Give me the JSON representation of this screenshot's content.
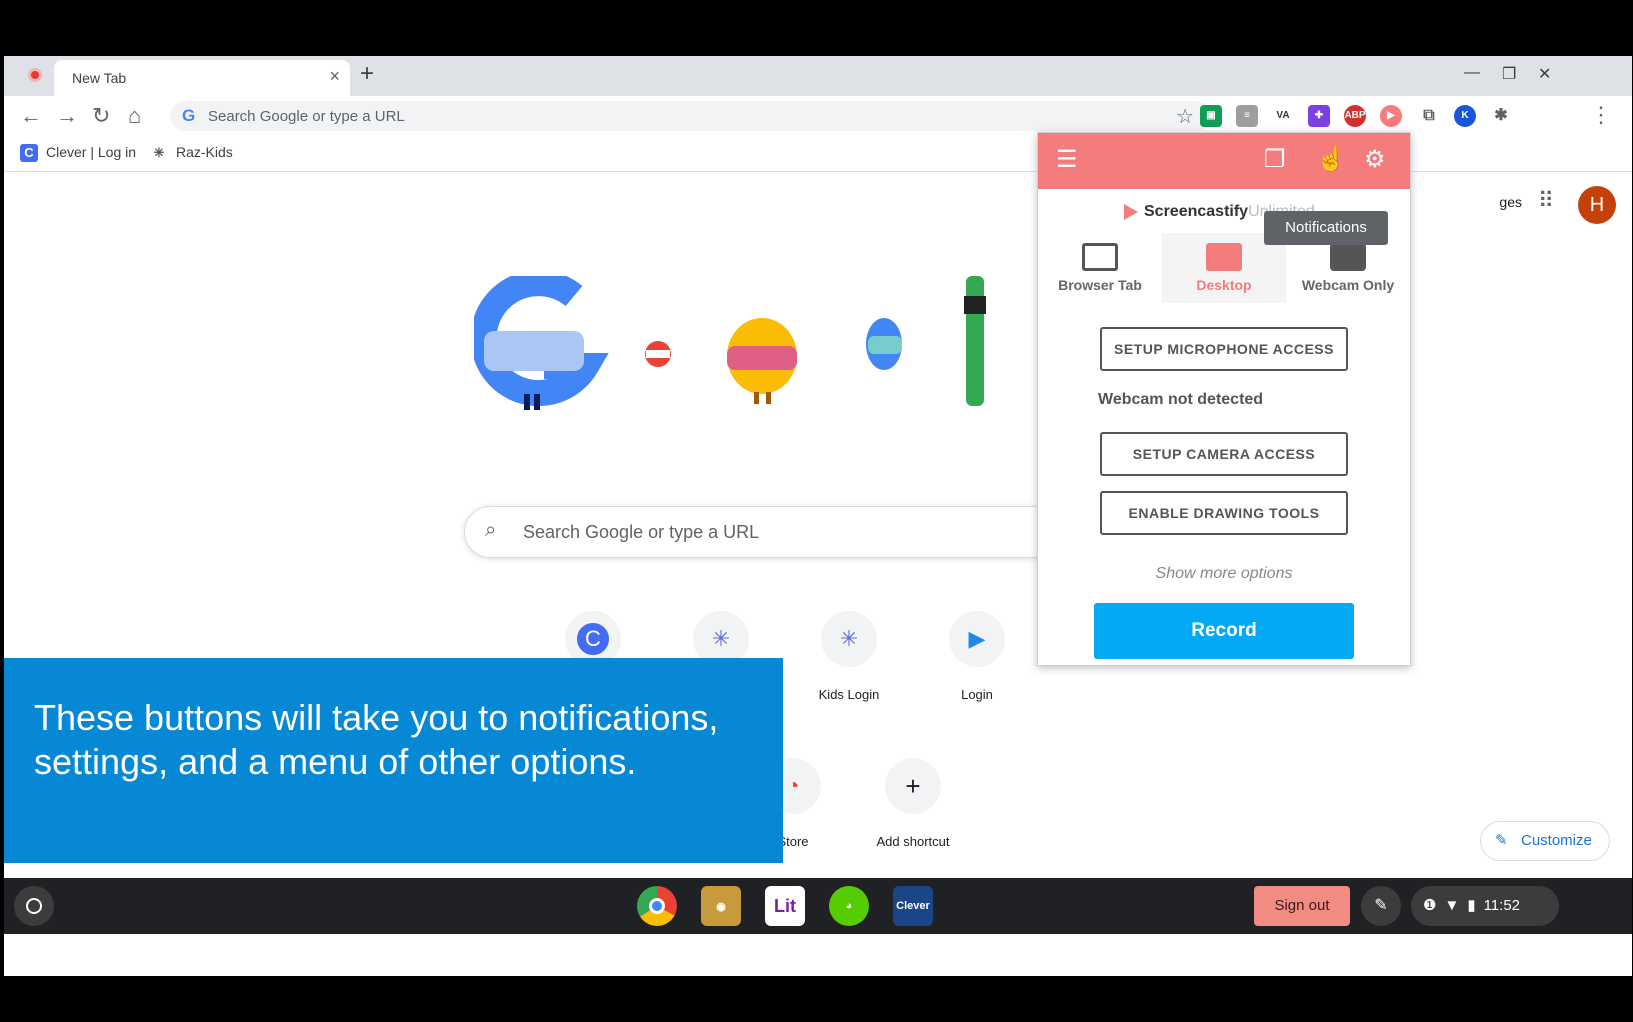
{
  "browser": {
    "tab_title": "New Tab",
    "omnibox_placeholder": "Search Google or type a URL"
  },
  "bookmarks": [
    {
      "label": "Clever | Log in",
      "icon": "clever-icon"
    },
    {
      "label": "Raz-Kids",
      "icon": "raz-kids-icon"
    }
  ],
  "ntp": {
    "search_placeholder": "Search Google or type a URL",
    "images_link": "ges",
    "avatar_letter": "H",
    "shortcuts": [
      {
        "label": "",
        "glyph": "C"
      },
      {
        "label": "",
        "glyph": "✳"
      },
      {
        "label": "Kids Login",
        "glyph": "✳"
      },
      {
        "label": "Login",
        "glyph": "▶"
      },
      {
        "label": "Store",
        "glyph": "◔"
      },
      {
        "label": "Add shortcut",
        "glyph": "+"
      }
    ],
    "customize_label": "Customize"
  },
  "caption": {
    "text": "These buttons will take you to notifications, settings, and a menu of other options."
  },
  "popup": {
    "brand": "Screencastify",
    "brand_sub": "Unlimited",
    "tooltip": "Notifications",
    "modes": [
      {
        "label": "Browser Tab"
      },
      {
        "label": "Desktop"
      },
      {
        "label": "Webcam Only"
      }
    ],
    "setup_mic": "SETUP MICROPHONE ACCESS",
    "webcam_msg": "Webcam not detected",
    "setup_camera": "SETUP CAMERA ACCESS",
    "enable_drawing": "ENABLE DRAWING TOOLS",
    "more_options": "Show more options",
    "record": "Record"
  },
  "shelf": {
    "apps": [
      "chrome",
      "game",
      "lit",
      "duolingo",
      "Clever"
    ],
    "sign_out": "Sign out",
    "time": "11:52"
  },
  "colors": {
    "popup_accent": "#f47c7c",
    "record_blue": "#03a9f4",
    "caption_blue": "#0688d4"
  }
}
